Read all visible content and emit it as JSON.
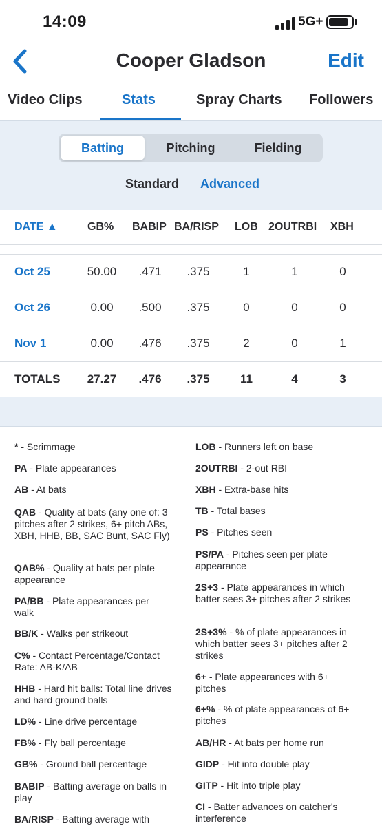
{
  "status": {
    "time": "14:09",
    "network": "5G+"
  },
  "header": {
    "title": "Cooper Gladson",
    "edit_label": "Edit"
  },
  "tabs": [
    "Video Clips",
    "Stats",
    "Spray Charts",
    "Followers"
  ],
  "segments": [
    "Batting",
    "Pitching",
    "Fielding"
  ],
  "subtabs": [
    "Standard",
    "Advanced"
  ],
  "table": {
    "headers": [
      "DATE ▲",
      "GB%",
      "BABIP",
      "BA/RISP",
      "LOB",
      "2OUTRBI",
      "XBH"
    ],
    "rows": [
      [
        "Oct 25",
        "50.00",
        ".471",
        ".375",
        "1",
        "1",
        "0"
      ],
      [
        "Oct 26",
        "0.00",
        ".500",
        ".375",
        "0",
        "0",
        "0"
      ],
      [
        "Nov 1",
        "0.00",
        ".476",
        ".375",
        "2",
        "0",
        "1"
      ],
      [
        "TOTALS",
        "27.27",
        ".476",
        ".375",
        "11",
        "4",
        "3"
      ]
    ]
  },
  "legend_left": [
    {
      "key": "*",
      "desc": " - Scrimmage"
    },
    {
      "key": "PA",
      "desc": " - Plate appearances"
    },
    {
      "key": "AB",
      "desc": " - At bats"
    },
    {
      "key": "QAB",
      "desc": " - Quality at bats (any one of: 3 pitches after 2 strikes, 6+ pitch ABs, XBH, HHB, BB, SAC Bunt, SAC Fly)"
    },
    {
      "key": "QAB%",
      "desc": " - Quality at bats per plate appearance"
    },
    {
      "key": "PA/BB",
      "desc": " - Plate appearances per walk"
    },
    {
      "key": "BB/K",
      "desc": " - Walks per strikeout"
    },
    {
      "key": "C%",
      "desc": " - Contact Percentage/Contact Rate: AB-K/AB"
    },
    {
      "key": "HHB",
      "desc": " - Hard hit balls: Total line drives and hard ground balls"
    },
    {
      "key": "LD%",
      "desc": " - Line drive percentage"
    },
    {
      "key": "FB%",
      "desc": " - Fly ball percentage"
    },
    {
      "key": "GB%",
      "desc": " - Ground ball percentage"
    },
    {
      "key": "BABIP",
      "desc": " - Batting average on balls in play"
    },
    {
      "key": "BA/RISP",
      "desc": " - Batting average with"
    }
  ],
  "legend_right": [
    {
      "key": "LOB",
      "desc": " - Runners left on base"
    },
    {
      "key": "2OUTRBI",
      "desc": " - 2-out RBI"
    },
    {
      "key": "XBH",
      "desc": " - Extra-base hits"
    },
    {
      "key": "TB",
      "desc": " - Total bases"
    },
    {
      "key": "PS",
      "desc": " - Pitches seen"
    },
    {
      "key": "PS/PA",
      "desc": " - Pitches seen per plate appearance"
    },
    {
      "key": "2S+3",
      "desc": " - Plate appearances in which batter sees 3+ pitches after 2 strikes"
    },
    {
      "key": "2S+3%",
      "desc": " - % of plate appearances in which batter sees 3+ pitches after 2 strikes"
    },
    {
      "key": "6+",
      "desc": " - Plate appearances with 6+ pitches"
    },
    {
      "key": "6+%",
      "desc": " - % of plate appearances of 6+ pitches"
    },
    {
      "key": "AB/HR",
      "desc": " - At bats per home run"
    },
    {
      "key": "GIDP",
      "desc": " - Hit into double play"
    },
    {
      "key": "GITP",
      "desc": " - Hit into triple play"
    },
    {
      "key": "CI",
      "desc": " - Batter advances on catcher's interference"
    }
  ],
  "colors": {
    "accent": "#1a75c9",
    "panel": "#e8eff7"
  }
}
